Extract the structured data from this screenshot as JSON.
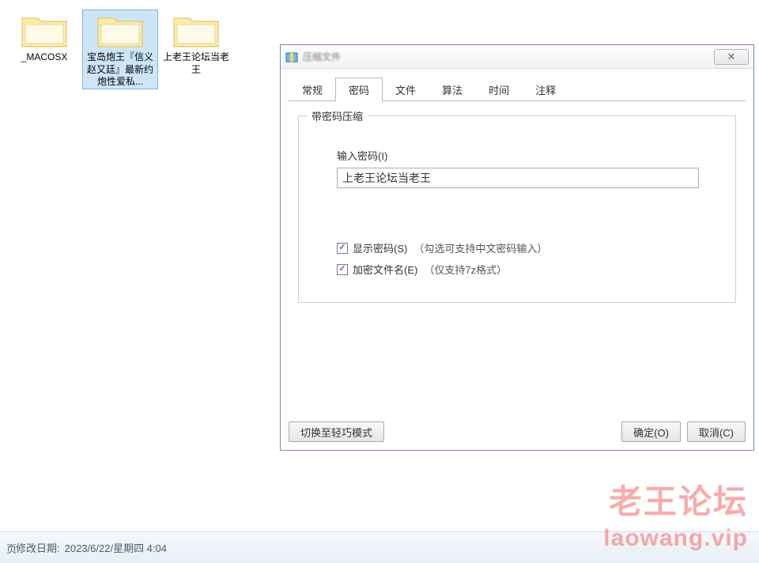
{
  "folders": [
    {
      "label": "_MACOSX",
      "selected": false
    },
    {
      "label": "宝岛炮王『信义赵又廷』最新约炮性爱私...",
      "selected": true
    },
    {
      "label": "上老王论坛当老王",
      "selected": false
    }
  ],
  "dialog": {
    "title_blur": "压缩文件",
    "close_glyph": "✕",
    "tabs": [
      "常规",
      "密码",
      "文件",
      "算法",
      "时间",
      "注释"
    ],
    "active_tab_index": 1,
    "group_title": "带密码压缩",
    "password": {
      "label": "输入密码(I)",
      "value": "上老王论坛当老王"
    },
    "checkboxes": [
      {
        "label": "显示密码(S)",
        "hint": "（勾选可支持中文密码输入）",
        "checked": true
      },
      {
        "label": "加密文件名(E)",
        "hint": "（仅支持7z格式）",
        "checked": true
      }
    ],
    "footer": {
      "switch_mode": "切换至轻巧模式",
      "ok": "确定(O)",
      "cancel": "取消(C)"
    }
  },
  "statusbar": {
    "label": "修改日期:",
    "value": "2023/6/22/星期四 4:04",
    "left_stub": "页"
  },
  "watermark": {
    "line1": "老王论坛",
    "line2": "laowang.vip"
  }
}
